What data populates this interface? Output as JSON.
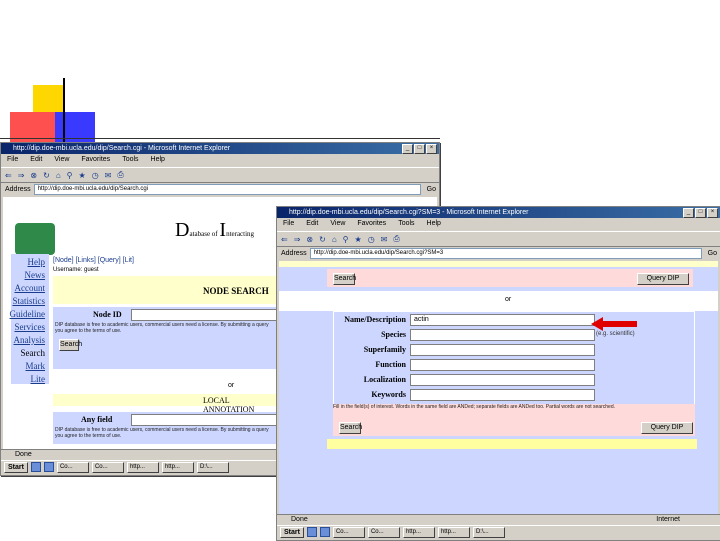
{
  "left_window": {
    "title": "http://dip.doe-mbi.ucla.edu/dip/Search.cgi - Microsoft Internet Explorer",
    "menu": [
      "File",
      "Edit",
      "View",
      "Favorites",
      "Tools",
      "Help"
    ],
    "address_label": "Address",
    "address": "http://dip.doe-mbi.ucla.edu/dip/Search.cgi",
    "go_label": "Go",
    "site_title_big1": "D",
    "site_title_small1": "atabase of ",
    "site_title_big2": "I",
    "site_title_small2": "nteracting ",
    "nav": [
      "Help",
      "News",
      "Account",
      "Statistics",
      "Guideline",
      "Services",
      "Analysis",
      "Search",
      "Mark",
      "Lite"
    ],
    "tab_links": "[Node] [Links] [Query] [Lit]",
    "user_line": "Username: guest",
    "node_search": "NODE SEARCH",
    "node_id_label": "Node ID",
    "disclaimer": "DIP database is free to academic users, commercial users need a license. By submitting a query you agree to the terms of use.",
    "search_button": "Search",
    "or_label": "or",
    "any_field_label": "Any field",
    "local_annotation": "LOCAL ANNOTATION",
    "status": "Done"
  },
  "right_window": {
    "title": "http://dip.doe-mbi.ucla.edu/dip/Search.cgi?SM=3 - Microsoft Internet Explorer",
    "address": "http://dip.doe-mbi.ucla.edu/dip/Search.cgi?SM=3",
    "query_dip_top": "Query DIP",
    "search_top": "Search",
    "or_label": "or",
    "fields": [
      {
        "label": "Name/Description",
        "value": "actin"
      },
      {
        "label": "Species",
        "value": ""
      },
      {
        "label": "Superfamily",
        "value": ""
      },
      {
        "label": "Function",
        "value": ""
      },
      {
        "label": "Localization",
        "value": ""
      },
      {
        "label": "Keywords",
        "value": ""
      }
    ],
    "species_hint": "(e.g. scientific)",
    "footer_note": "Fill in the field(s) of interest. Words in the same field are ANDed; separate fields are ANDed too. Partial words are not searched.",
    "search_bottom": "Search",
    "query_dip_bottom": "Query DIP",
    "status": "Done",
    "zone": "Internet"
  },
  "taskbar": {
    "start": "Start",
    "items": [
      "Co...",
      "Co...",
      "http...",
      "http...",
      "D:\\..."
    ]
  },
  "colors": {
    "titlebar": "#0a246a",
    "nav_bg": "#ccd6ff",
    "panel_yellow": "#ffffcc",
    "panel_pink": "#ffdada",
    "arrow": "#e00000"
  }
}
